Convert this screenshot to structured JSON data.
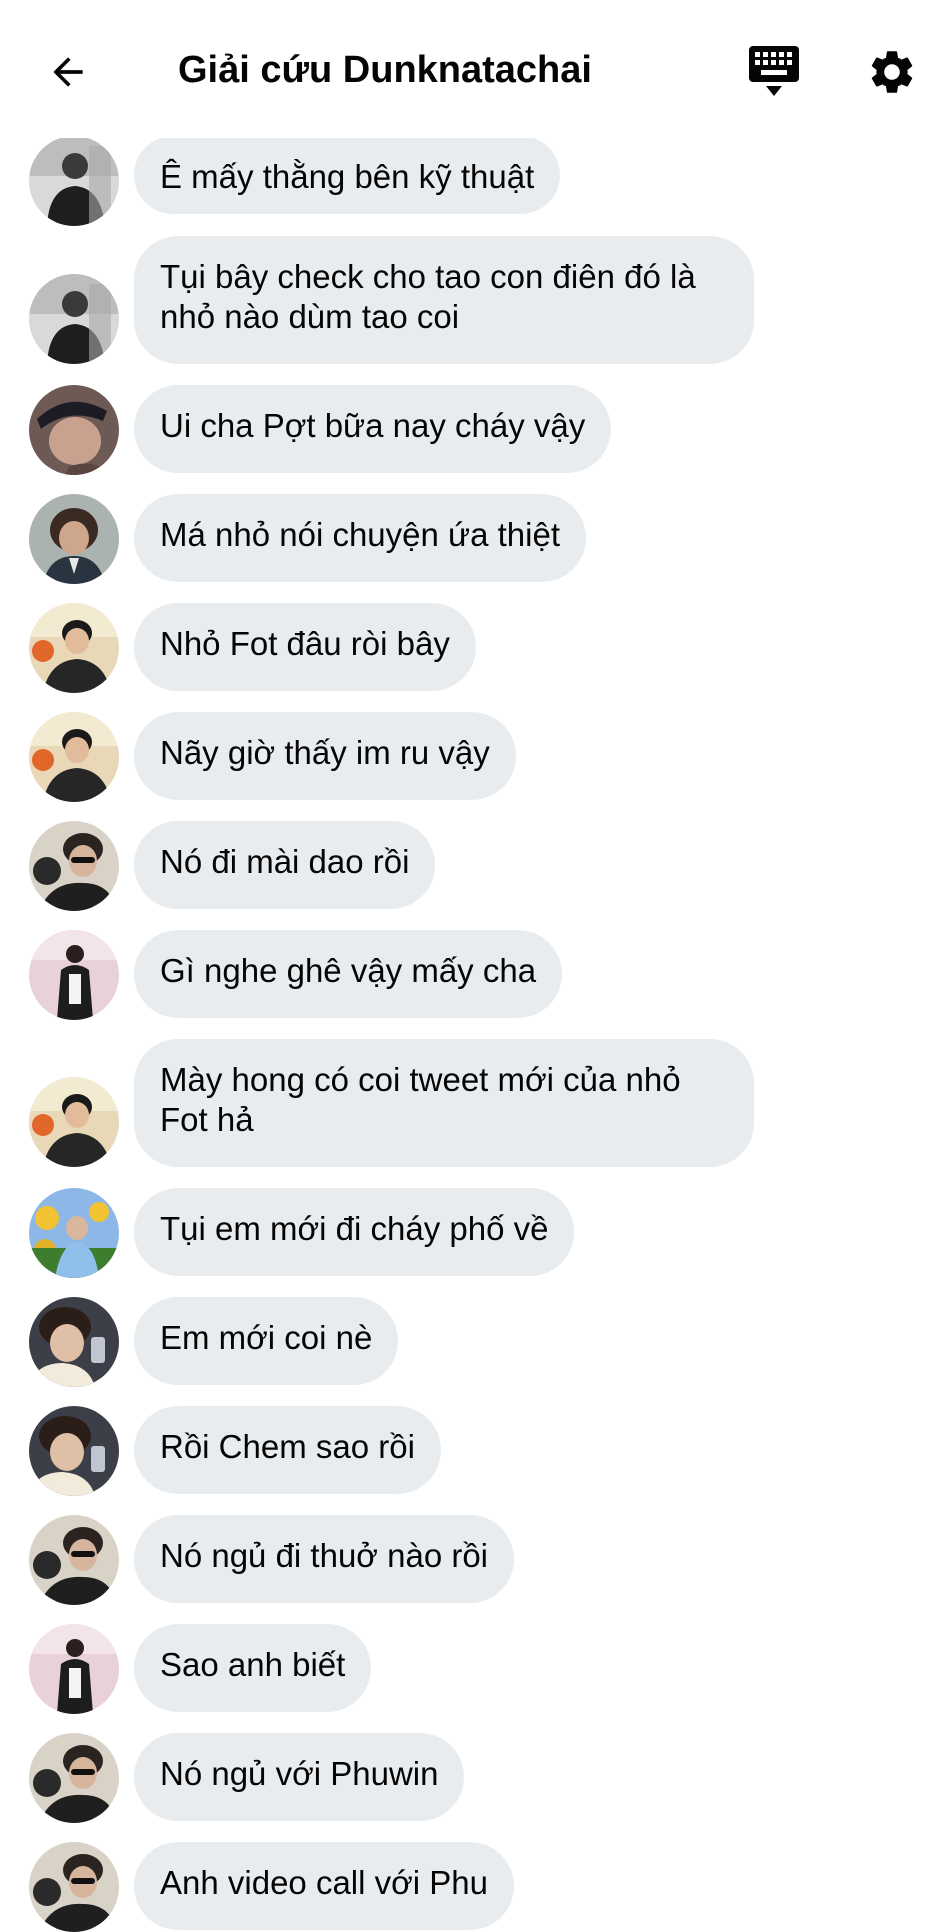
{
  "header": {
    "title": "Giải cứu Dunknatachai",
    "back_icon": "arrow-left-icon",
    "keyboard_icon": "keyboard-icon",
    "settings_icon": "gear-icon"
  },
  "colors": {
    "bubble": "#e9ecef",
    "text": "#050505",
    "background": "#ffffff"
  },
  "messages": [
    {
      "text": "Ê mấy thằng bên kỹ thuật",
      "avatar": "avatar-bw-man"
    },
    {
      "text": "Tụi bây check cho tao con điên đó là\nnhỏ nào dùm tao coi",
      "avatar": "avatar-bw-man"
    },
    {
      "text": "Ui cha Pợt bữa nay cháy vậy",
      "avatar": "avatar-cap-man"
    },
    {
      "text": "Má nhỏ nói chuyện ứa thiệt",
      "avatar": "avatar-curly-man"
    },
    {
      "text": "Nhỏ Fot đâu ròi bây",
      "avatar": "avatar-smiling-man"
    },
    {
      "text": "Nãy giờ thấy im ru vậy",
      "avatar": "avatar-smiling-man"
    },
    {
      "text": "Nó đi mài dao rồi",
      "avatar": "avatar-sunglasses-man"
    },
    {
      "text": "Gì nghe ghê vậy mấy cha",
      "avatar": "avatar-pink-man"
    },
    {
      "text": "Mày hong có coi tweet mới của nhỏ\nFot hả",
      "avatar": "avatar-smiling-man"
    },
    {
      "text": "Tụi em mới đi cháy phố về",
      "avatar": "avatar-sunflower-man"
    },
    {
      "text": "Em mới coi nè",
      "avatar": "avatar-selfie-man"
    },
    {
      "text": "Rồi Chem sao rồi",
      "avatar": "avatar-selfie-man"
    },
    {
      "text": "Nó ngủ đi thuở nào rồi",
      "avatar": "avatar-sunglasses-man"
    },
    {
      "text": "Sao anh biết",
      "avatar": "avatar-pink-man"
    },
    {
      "text": "Nó ngủ với Phuwin",
      "avatar": "avatar-sunglasses-man"
    },
    {
      "text": "Anh video call với Phu",
      "avatar": "avatar-sunglasses-man"
    }
  ]
}
